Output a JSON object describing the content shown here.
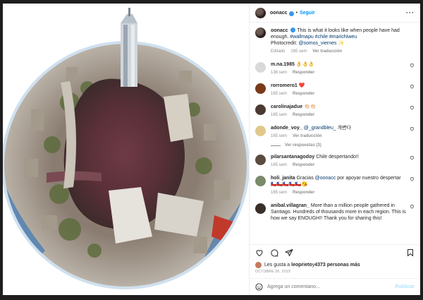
{
  "post": {
    "username": "oonacc",
    "follow_label": "Seguir",
    "caption": {
      "username": "oonacc",
      "text": "This is what it looks like when people have had enough.",
      "hashtags": "#wallmapu #chile #marichiweu",
      "credit_prefix": "Photocredit: ",
      "credit_handle": "@somos_viernes",
      "credit_suffix": " ✨",
      "meta_edited": "Editado",
      "meta_time": "165 sem",
      "meta_translate": "Ver traducción"
    }
  },
  "comments": [
    {
      "username": "m.na.1985",
      "text": "👌👌👌",
      "time": "136 sem",
      "reply": "Responder",
      "avatar_color": "#d9d9d9"
    },
    {
      "username": "rorromero1",
      "text": "❤️",
      "time": "165 sem",
      "reply": "Responder",
      "avatar_color": "#7a3a1a"
    },
    {
      "username": "carolinajadue",
      "text": "👏🏻👏🏻",
      "time": "165 sem",
      "reply": "Responder",
      "avatar_color": "#4a3a32"
    },
    {
      "username": "adonde_voy_",
      "mention": "@_grandbleu_",
      "text": " 개변다",
      "time": "165 sem",
      "translate": "Ver traducción",
      "avatar_color": "#e0c88a"
    },
    {
      "username": "pilarsantanagodoy",
      "text": "Chile despertando!!",
      "time": "165 sem",
      "reply": "Responder",
      "avatar_color": "#5a4a40"
    },
    {
      "username": "holi_janita",
      "text_a": "Gracias ",
      "mention": "@oonacc",
      "text_b": " por apoyar nuestro despertar",
      "text_c": "🇨🇱🇨🇱🇨🇱🇨🇱🇨🇱😘",
      "time": "165 sem",
      "reply": "Responder",
      "avatar_color": "#7a8a6a"
    },
    {
      "username": "anibal.villagran_",
      "text": "More than a million people gathered in Santiago. Hundreds of thousands more in each region. This is how we say ENOUGH!! Thank you for sharing this!",
      "time": "",
      "reply": "",
      "avatar_color": "#3a2e2a"
    }
  ],
  "replies_label": "Ver respuestas (3)",
  "likes": {
    "prefix": "Les gusta a ",
    "user": "leoprieto",
    "mid": " y ",
    "count": "4373 personas más"
  },
  "date": "OCTUBRE 26, 2019",
  "comment_box": {
    "placeholder": "Agrega un comentario...",
    "publish": "Publicar"
  },
  "icons": [
    "heart-icon",
    "comment-icon",
    "share-icon",
    "save-icon",
    "emoji-icon",
    "more-icon",
    "verified-icon"
  ]
}
